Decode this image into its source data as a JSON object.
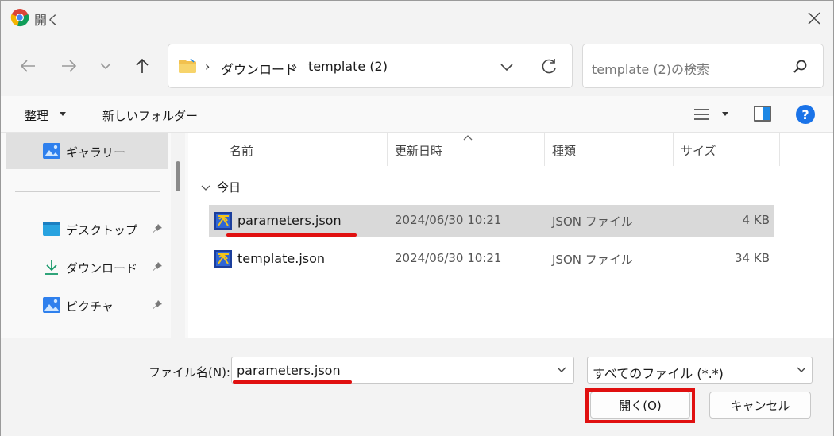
{
  "window": {
    "title": "開く"
  },
  "nav": {
    "breadcrumb": [
      "ダウンロード",
      "template (2)"
    ],
    "search_placeholder": "template (2)の検索"
  },
  "toolbar": {
    "organize": "整理",
    "new_folder": "新しいフォルダー"
  },
  "sidebar": {
    "items": [
      {
        "label": "ギャラリー",
        "icon": "gallery-icon",
        "selected": true,
        "pinned": false
      },
      {
        "label": "デスクトップ",
        "icon": "desktop-icon",
        "pinned": true
      },
      {
        "label": "ダウンロード",
        "icon": "download-icon",
        "pinned": true
      },
      {
        "label": "ピクチャ",
        "icon": "pictures-icon",
        "pinned": true
      }
    ]
  },
  "files": {
    "columns": {
      "name": "名前",
      "date": "更新日時",
      "type": "種類",
      "size": "サイズ"
    },
    "group_label": "今日",
    "rows": [
      {
        "name": "parameters.json",
        "date": "2024/06/30 10:21",
        "type": "JSON ファイル",
        "size": "4 KB",
        "selected": true
      },
      {
        "name": "template.json",
        "date": "2024/06/30 10:21",
        "type": "JSON ファイル",
        "size": "34 KB",
        "selected": false
      }
    ]
  },
  "bottom": {
    "filename_label": "ファイル名(N):",
    "filename_value": "parameters.json",
    "filter_value": "すべてのファイル (*.*)",
    "open_button": "開く(O)",
    "cancel_button": "キャンセル"
  },
  "colors": {
    "annotation_red": "#e01010",
    "selected_row": "#d9d9d9",
    "accent_blue": "#1a73e8"
  }
}
